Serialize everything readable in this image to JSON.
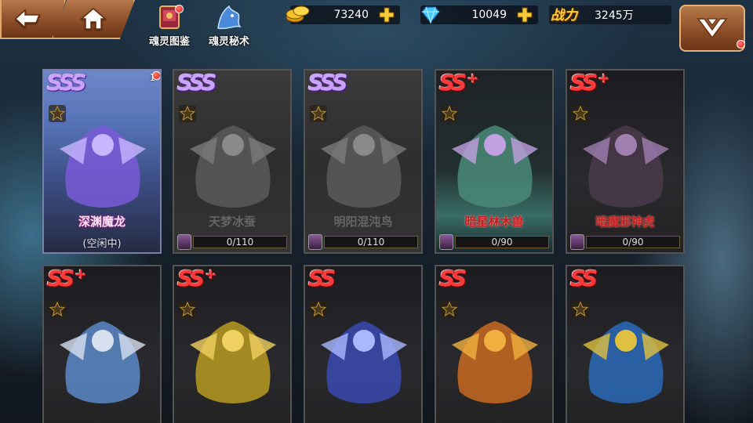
{
  "top_bar": {
    "back_icon": "back-arrow-icon",
    "home_icon": "home-icon",
    "quick_links": [
      {
        "label": "魂灵图鉴",
        "icon": "book-icon"
      },
      {
        "label": "魂灵秘术",
        "icon": "beast-head-icon"
      }
    ],
    "gold": {
      "icon": "gold-coin-icon",
      "value": "73240"
    },
    "diamond": {
      "icon": "diamond-icon",
      "value": "10049"
    },
    "power": {
      "label": "战力",
      "value": "3245万"
    },
    "menu_icon": "chevron-down-menu-icon"
  },
  "colors": {
    "accent_frame": "#e0a86c",
    "sss_rank": "#c9a3ff",
    "ss_rank": "#ff3a3a",
    "notify": "#e01010"
  },
  "cards": [
    {
      "rank": "SSS",
      "plus": "",
      "name": "深渊魔龙",
      "status": "(空闲中)",
      "count": "1",
      "progress_text": "",
      "progress": null,
      "state": "owned"
    },
    {
      "rank": "SSS",
      "plus": "",
      "name": "天梦冰蚕",
      "status": "",
      "count": "",
      "progress_text": "0/110",
      "progress": 0,
      "state": "locked"
    },
    {
      "rank": "SSS",
      "plus": "",
      "name": "明阳混沌鸟",
      "status": "",
      "count": "",
      "progress_text": "0/110",
      "progress": 0,
      "state": "locked"
    },
    {
      "rank": "SS",
      "plus": "+",
      "name": "暗星林木兽",
      "status": "",
      "count": "",
      "progress_text": "0/90",
      "progress": 0,
      "state": "locked"
    },
    {
      "rank": "SS",
      "plus": "+",
      "name": "暗魔邪神虎",
      "status": "",
      "count": "",
      "progress_text": "0/90",
      "progress": 0,
      "state": "locked"
    },
    {
      "rank": "SS",
      "plus": "+",
      "name": "",
      "status": "",
      "count": "",
      "progress_text": "",
      "progress": null,
      "state": "locked"
    },
    {
      "rank": "SS",
      "plus": "+",
      "name": "",
      "status": "",
      "count": "",
      "progress_text": "",
      "progress": null,
      "state": "locked"
    },
    {
      "rank": "SS",
      "plus": "",
      "name": "",
      "status": "",
      "count": "",
      "progress_text": "",
      "progress": null,
      "state": "locked"
    },
    {
      "rank": "SS",
      "plus": "",
      "name": "",
      "status": "",
      "count": "",
      "progress_text": "",
      "progress": null,
      "state": "locked"
    },
    {
      "rank": "SS",
      "plus": "",
      "name": "",
      "status": "",
      "count": "",
      "progress_text": "",
      "progress": null,
      "state": "locked"
    }
  ]
}
